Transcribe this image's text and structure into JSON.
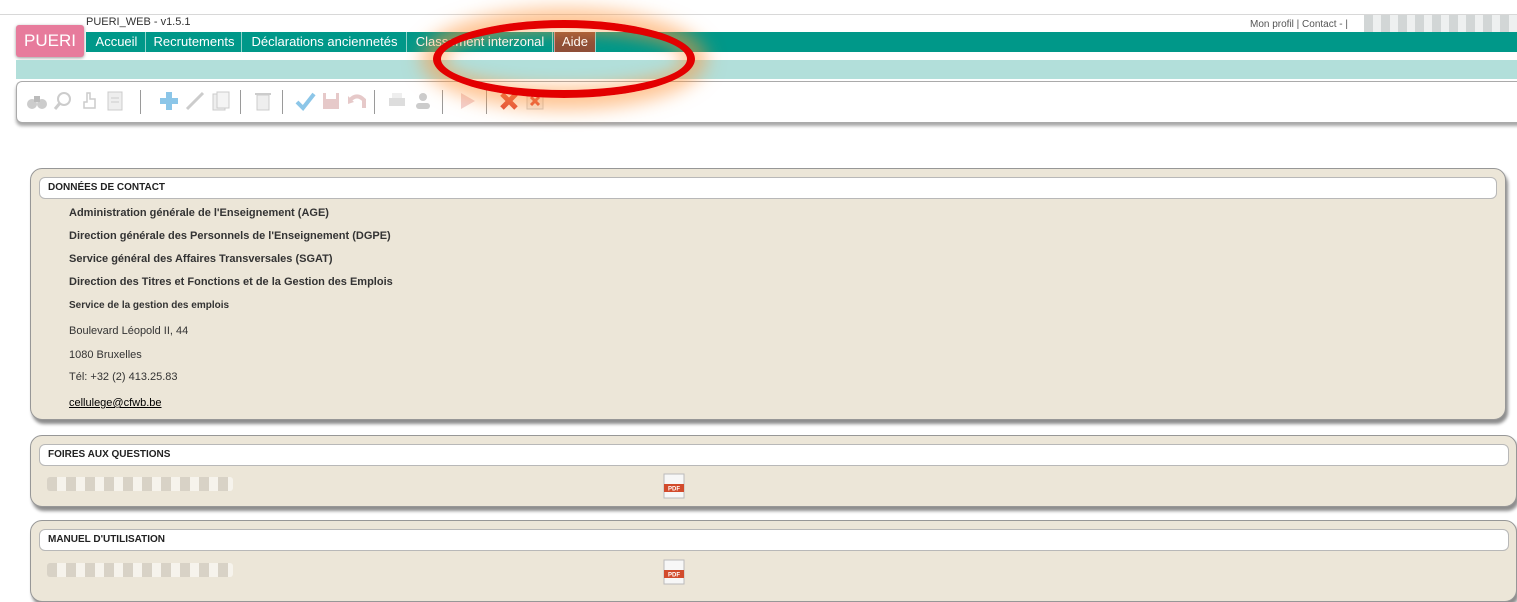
{
  "app": {
    "logo_text": "PUERI",
    "name_version": "PUERI_WEB - v1.5.1"
  },
  "header": {
    "profile_links": "Mon profil | Contact - |"
  },
  "nav": {
    "items": [
      {
        "label": "Accueil"
      },
      {
        "label": "Recrutements"
      },
      {
        "label": "Déclarations anciennetés"
      },
      {
        "label": "Classement interzonal"
      },
      {
        "label": "Aide"
      }
    ],
    "active": "Aide"
  },
  "toolbar": {
    "icons": [
      "binoculars-icon",
      "magnifier-icon",
      "hand-pointer-icon",
      "document-icon",
      "add-icon",
      "edit-pencil-icon",
      "copy-icon",
      "delete-trash-icon",
      "validate-check-icon",
      "save-disk-icon",
      "undo-icon",
      "print-icon",
      "user-icon",
      "play-icon",
      "close-red-x-icon",
      "close-window-icon"
    ]
  },
  "contact": {
    "title": "DONNÉES DE CONTACT",
    "lines": [
      "Administration générale de l'Enseignement (AGE)",
      "Direction générale des Personnels de l'Enseignement (DGPE)",
      "Service général des Affaires Transversales (SGAT)",
      "Direction des Titres et Fonctions et de la Gestion des Emplois",
      "Service de la gestion des emplois",
      "Boulevard Léopold II, 44",
      "1080 Bruxelles",
      "Tél: +32 (2) 413.25.83"
    ],
    "email": "cellulege@cfwb.be"
  },
  "faq": {
    "title": "FOIRES AUX QUESTIONS",
    "doc_icon": "pdf-icon"
  },
  "manual": {
    "title": "MANUEL D'UTILISATION",
    "doc_icon": "pdf-icon"
  },
  "colors": {
    "navbar": "#009889",
    "subbar": "#b2dfda",
    "logo": "#e77b9c",
    "panel": "#ece6d8",
    "aide_tab": "#8f4f38",
    "highlight": "#e30000"
  }
}
